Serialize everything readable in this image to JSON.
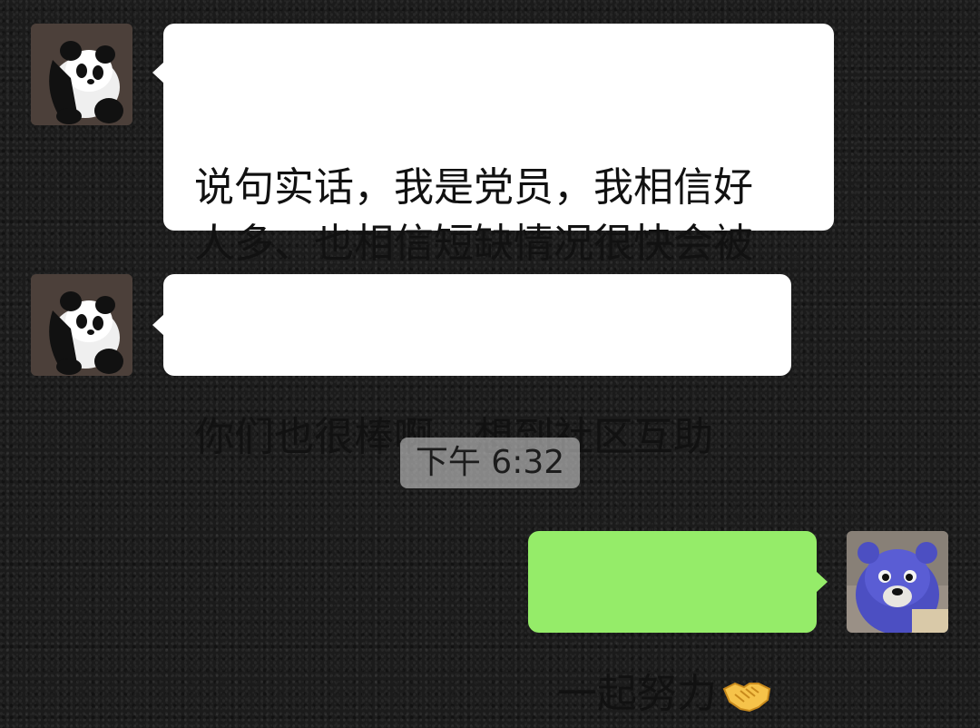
{
  "messages": [
    {
      "sender": "other",
      "avatar": "panda-avatar",
      "text": "说句实话，我是党员，我相信好\n人多、也相信短缺情况很快会被\n政府改善"
    },
    {
      "sender": "other",
      "avatar": "panda-avatar",
      "text": "你们也很棒啊，想到社区互助"
    },
    {
      "sender": "self",
      "avatar": "blue-bear-avatar",
      "text": "一起努力",
      "emoji": "handshake-icon"
    }
  ],
  "timestamp": "下午 6:32",
  "colors": {
    "background": "#1b1b1b",
    "incoming_bubble": "#ffffff",
    "outgoing_bubble": "#95ec69",
    "timestamp_bg": "#c8c8c8"
  }
}
